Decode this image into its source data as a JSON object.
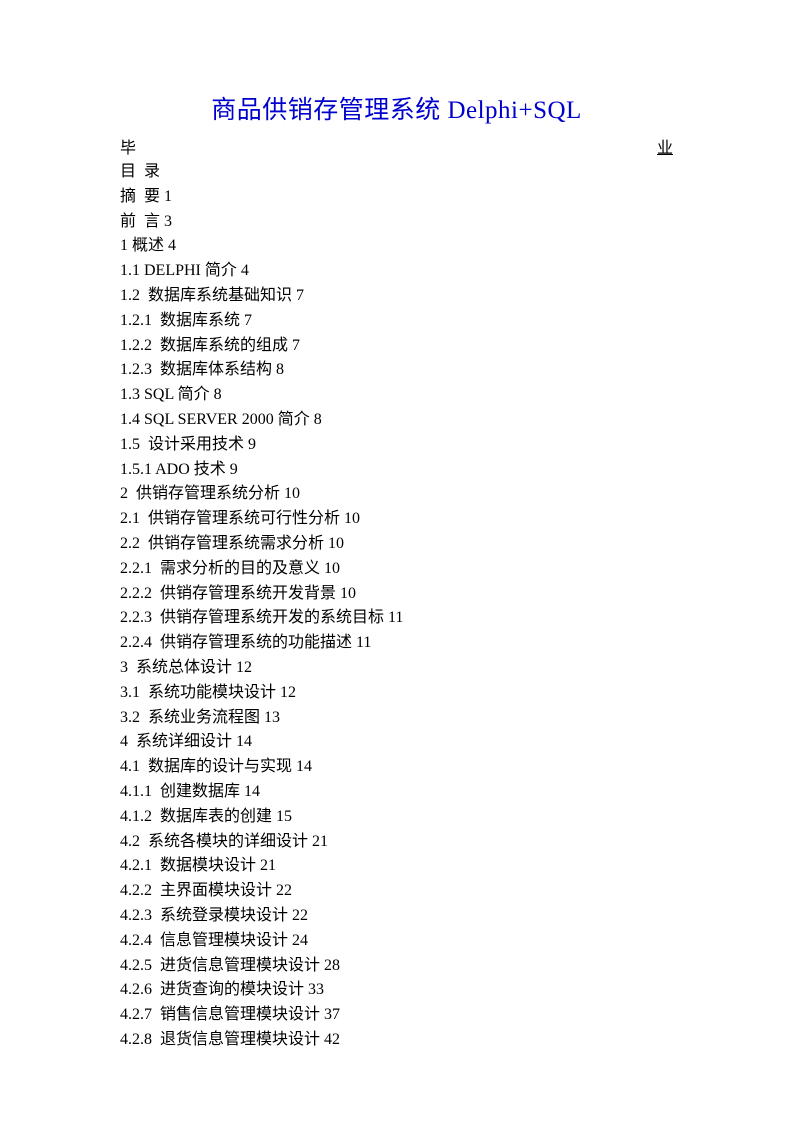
{
  "title": "商品供销存管理系统 Delphi+SQL",
  "header_left": "毕",
  "header_right": "业",
  "toc_header": "目  录",
  "entries": [
    "摘  要 1",
    "前  言 3",
    "1 概述 4",
    "1.1 DELPHI 简介 4",
    "1.2  数据库系统基础知识 7",
    "1.2.1  数据库系统 7",
    "1.2.2  数据库系统的组成 7",
    "1.2.3  数据库体系结构 8",
    "1.3 SQL 简介 8",
    "1.4 SQL SERVER 2000 简介 8",
    "1.5  设计采用技术 9",
    "1.5.1 ADO 技术 9",
    "2  供销存管理系统分析 10",
    "2.1  供销存管理系统可行性分析 10",
    "2.2  供销存管理系统需求分析 10",
    "2.2.1  需求分析的目的及意义 10",
    "2.2.2  供销存管理系统开发背景 10",
    "2.2.3  供销存管理系统开发的系统目标 11",
    "2.2.4  供销存管理系统的功能描述 11",
    "3  系统总体设计 12",
    "3.1  系统功能模块设计 12",
    "3.2  系统业务流程图 13",
    "4  系统详细设计 14",
    "4.1  数据库的设计与实现 14",
    "4.1.1  创建数据库 14",
    "4.1.2  数据库表的创建 15",
    "4.2  系统各模块的详细设计 21",
    "4.2.1  数据模块设计 21",
    "4.2.2  主界面模块设计 22",
    "4.2.3  系统登录模块设计 22",
    "4.2.4  信息管理模块设计 24",
    "4.2.5  进货信息管理模块设计 28",
    "4.2.6  进货查询的模块设计 33",
    "4.2.7  销售信息管理模块设计 37",
    "4.2.8  退货信息管理模块设计 42"
  ]
}
